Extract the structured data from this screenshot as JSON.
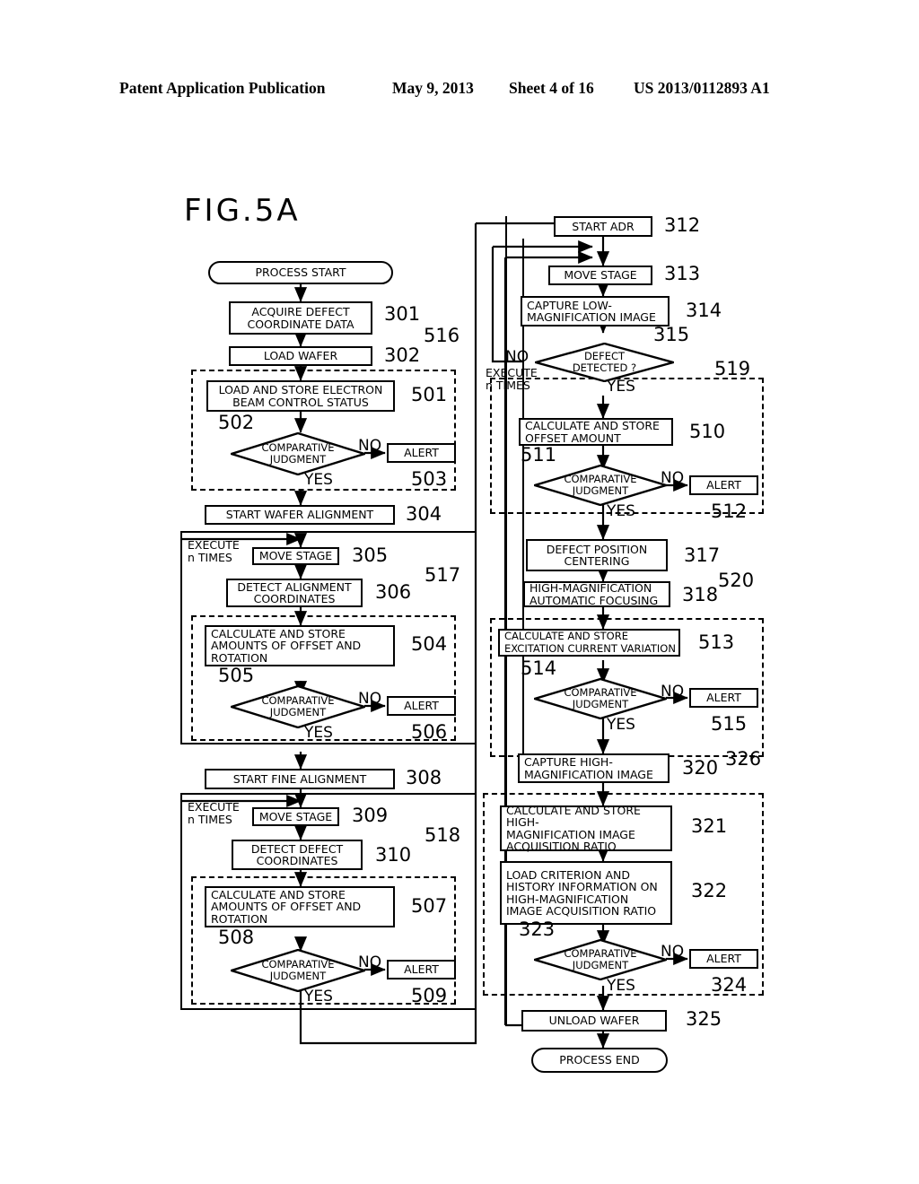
{
  "header": {
    "publication": "Patent Application Publication",
    "date": "May 9, 2013",
    "sheet": "Sheet 4 of 16",
    "patent_number": "US 2013/0112893 A1"
  },
  "figure": {
    "label": "FIG.5A",
    "type": "flowchart"
  },
  "labels": {
    "yes": "YES",
    "no": "NO",
    "execute_n_times": "EXECUTE\nn TIMES",
    "alert": "ALERT"
  },
  "left_column": {
    "nodes": [
      {
        "id": "process_start",
        "text": "PROCESS START",
        "shape": "terminator",
        "ref": ""
      },
      {
        "id": "n301",
        "text": "ACQUIRE DEFECT\nCOORDINATE DATA",
        "shape": "process",
        "ref": "301"
      },
      {
        "id": "n302",
        "text": "LOAD WAFER",
        "shape": "process",
        "ref": "302"
      },
      {
        "id": "n501",
        "text": "LOAD AND STORE ELECTRON\nBEAM CONTROL STATUS",
        "shape": "process",
        "ref": "501"
      },
      {
        "id": "n502",
        "text": "COMPARATIVE\nJUDGMENT",
        "shape": "decision",
        "ref": "502"
      },
      {
        "id": "n503",
        "text": "ALERT",
        "shape": "process",
        "ref": "503"
      },
      {
        "id": "n304",
        "text": "START WAFER ALIGNMENT",
        "shape": "process",
        "ref": "304"
      },
      {
        "id": "n305",
        "text": "MOVE STAGE",
        "shape": "process",
        "ref": "305"
      },
      {
        "id": "n306",
        "text": "DETECT ALIGNMENT\nCOORDINATES",
        "shape": "process",
        "ref": "306"
      },
      {
        "id": "n504",
        "text": "CALCULATE AND STORE\nAMOUNTS OF OFFSET AND\nROTATION",
        "shape": "process",
        "ref": "504"
      },
      {
        "id": "n505",
        "text": "COMPARATIVE\nJUDGMENT",
        "shape": "decision",
        "ref": "505"
      },
      {
        "id": "n506",
        "text": "ALERT",
        "shape": "process",
        "ref": "506"
      },
      {
        "id": "n308",
        "text": "START FINE ALIGNMENT",
        "shape": "process",
        "ref": "308"
      },
      {
        "id": "n309",
        "text": "MOVE STAGE",
        "shape": "process",
        "ref": "309"
      },
      {
        "id": "n310",
        "text": "DETECT DEFECT\nCOORDINATES",
        "shape": "process",
        "ref": "310"
      },
      {
        "id": "n507",
        "text": "CALCULATE AND STORE\nAMOUNTS OF OFFSET AND\nROTATION",
        "shape": "process",
        "ref": "507"
      },
      {
        "id": "n508",
        "text": "COMPARATIVE\nJUDGMENT",
        "shape": "decision",
        "ref": "508"
      },
      {
        "id": "n509",
        "text": "ALERT",
        "shape": "process",
        "ref": "509"
      }
    ],
    "group_refs": [
      "516",
      "517",
      "518"
    ]
  },
  "right_column": {
    "nodes": [
      {
        "id": "n312",
        "text": "START ADR",
        "shape": "process",
        "ref": "312"
      },
      {
        "id": "n313",
        "text": "MOVE STAGE",
        "shape": "process",
        "ref": "313"
      },
      {
        "id": "n314",
        "text": "CAPTURE LOW-\nMAGNIFICATION IMAGE",
        "shape": "process",
        "ref": "314"
      },
      {
        "id": "n315",
        "text": "DEFECT\nDETECTED ?",
        "shape": "decision",
        "ref": "315"
      },
      {
        "id": "n510",
        "text": "CALCULATE AND STORE\nOFFSET AMOUNT",
        "shape": "process",
        "ref": "510"
      },
      {
        "id": "n511",
        "text": "COMPARATIVE\nJUDGMENT",
        "shape": "decision",
        "ref": "511"
      },
      {
        "id": "n512",
        "text": "ALERT",
        "shape": "process",
        "ref": "512"
      },
      {
        "id": "n317",
        "text": "DEFECT POSITION\nCENTERING",
        "shape": "process",
        "ref": "317"
      },
      {
        "id": "n318",
        "text": "HIGH-MAGNIFICATION\nAUTOMATIC FOCUSING",
        "shape": "process",
        "ref": "318"
      },
      {
        "id": "n513",
        "text": "CALCULATE AND STORE\nEXCITATION CURRENT VARIATION",
        "shape": "process",
        "ref": "513"
      },
      {
        "id": "n514",
        "text": "COMPARATIVE\nJUDGMENT",
        "shape": "decision",
        "ref": "514"
      },
      {
        "id": "n515",
        "text": "ALERT",
        "shape": "process",
        "ref": "515"
      },
      {
        "id": "n320",
        "text": "CAPTURE HIGH-\nMAGNIFICATION IMAGE",
        "shape": "process",
        "ref": "320"
      },
      {
        "id": "n321",
        "text": "CALCULATE AND STORE HIGH-\nMAGNIFICATION IMAGE\nACQUISITION RATIO",
        "shape": "process",
        "ref": "321"
      },
      {
        "id": "n322",
        "text": "LOAD CRITERION AND\nHISTORY INFORMATION ON\nHIGH-MAGNIFICATION\nIMAGE ACQUISITION RATIO",
        "shape": "process",
        "ref": "322"
      },
      {
        "id": "n323",
        "text": "COMPARATIVE\nJUDGMENT",
        "shape": "decision",
        "ref": "323"
      },
      {
        "id": "n324",
        "text": "ALERT",
        "shape": "process",
        "ref": "324"
      },
      {
        "id": "n325",
        "text": "UNLOAD WAFER",
        "shape": "process",
        "ref": "325"
      },
      {
        "id": "process_end",
        "text": "PROCESS END",
        "shape": "terminator",
        "ref": ""
      }
    ],
    "group_refs": [
      "519",
      "520",
      "326"
    ]
  }
}
